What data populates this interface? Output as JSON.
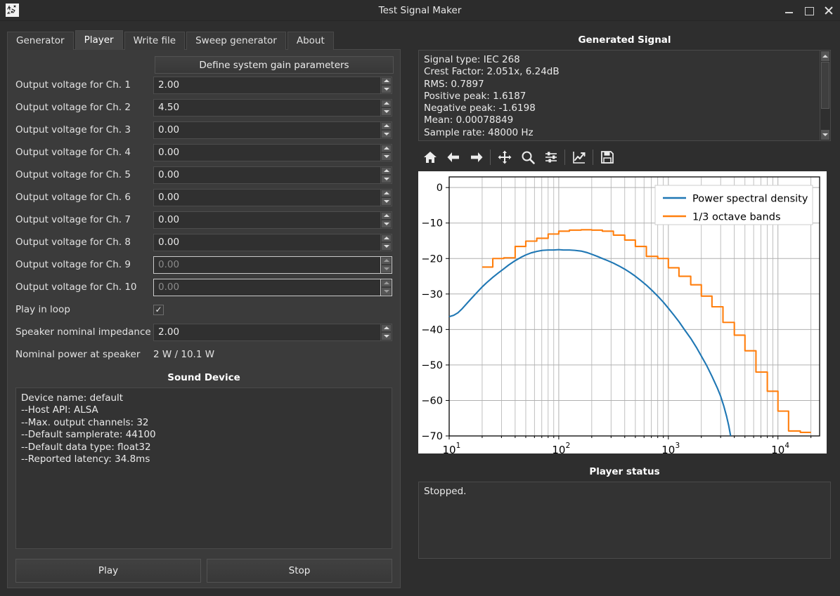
{
  "window": {
    "title": "Test Signal Maker",
    "app_icon": "signal-doodle-icon",
    "minimize": "–",
    "maximize": "□",
    "close": "✕"
  },
  "tabs": [
    {
      "label": "Generator",
      "active": false
    },
    {
      "label": "Player",
      "active": true
    },
    {
      "label": "Write file",
      "active": false
    },
    {
      "label": "Sweep generator",
      "active": false
    },
    {
      "label": "About",
      "active": false
    }
  ],
  "player": {
    "gain_button": "Define system gain parameters",
    "channels": [
      {
        "label": "Output voltage for Ch. 1",
        "value": "2.00",
        "enabled": true
      },
      {
        "label": "Output voltage for Ch. 2",
        "value": "4.50",
        "enabled": true
      },
      {
        "label": "Output voltage for Ch. 3",
        "value": "0.00",
        "enabled": true
      },
      {
        "label": "Output voltage for Ch. 4",
        "value": "0.00",
        "enabled": true
      },
      {
        "label": "Output voltage for Ch. 5",
        "value": "0.00",
        "enabled": true
      },
      {
        "label": "Output voltage for Ch. 6",
        "value": "0.00",
        "enabled": true
      },
      {
        "label": "Output voltage for Ch. 7",
        "value": "0.00",
        "enabled": true
      },
      {
        "label": "Output voltage for Ch. 8",
        "value": "0.00",
        "enabled": true
      },
      {
        "label": "Output voltage for Ch. 9",
        "value": "0.00",
        "enabled": false
      },
      {
        "label": "Output voltage for Ch. 10",
        "value": "0.00",
        "enabled": false
      }
    ],
    "loop_label": "Play in loop",
    "loop_checked": "✓",
    "impedance_label": "Speaker nominal impedance",
    "impedance_value": "2.00",
    "power_label": "Nominal power at speaker",
    "power_value": "2 W / 10.1 W",
    "play_button": "Play",
    "stop_button": "Stop"
  },
  "sound_device": {
    "title": "Sound Device",
    "text": "Device name: default\n--Host API: ALSA\n--Max. output channels: 32\n--Default samplerate: 44100\n--Default data type: float32\n--Reported latency: 34.8ms"
  },
  "generated_signal": {
    "title": "Generated Signal",
    "text": "Signal type: IEC 268\nCrest Factor: 2.051x, 6.24dB\nRMS: 0.7897\nPositive peak: 1.6187\nNegative peak: -1.6198\nMean: 0.00078849\nSample rate: 48000 Hz"
  },
  "plot_toolbar": [
    {
      "icon": "home-icon",
      "title": "Home"
    },
    {
      "icon": "arrow-left-icon",
      "title": "Back"
    },
    {
      "icon": "arrow-right-icon",
      "title": "Forward"
    },
    {
      "icon": "move-pan-icon",
      "title": "Pan"
    },
    {
      "icon": "magnifier-zoom-icon",
      "title": "Zoom"
    },
    {
      "icon": "sliders-configure-icon",
      "title": "Configure subplots"
    },
    {
      "icon": "edit-curves-icon",
      "title": "Edit axis/curve"
    },
    {
      "icon": "floppy-save-icon",
      "title": "Save figure"
    }
  ],
  "player_status": {
    "title": "Player status",
    "text": "Stopped."
  },
  "chart_data": {
    "type": "line",
    "title": "",
    "xlabel": "",
    "ylabel": "",
    "xscale": "log",
    "xlim": [
      10,
      24000
    ],
    "ylim": [
      -70,
      3
    ],
    "yticks": [
      0,
      -10,
      -20,
      -30,
      -40,
      -50,
      -60,
      -70
    ],
    "ytick_labels": [
      "0",
      "−10",
      "−20",
      "−30",
      "−40",
      "−50",
      "−60",
      "−70"
    ],
    "xticks": [
      10,
      100,
      1000,
      10000
    ],
    "xtick_labels": [
      "10¹",
      "10²",
      "10³",
      "10⁴"
    ],
    "grid": true,
    "legend_position": "upper right",
    "series": [
      {
        "name": "Power spectral density",
        "color": "#1f77b4",
        "style": "smooth",
        "points": [
          [
            10,
            -36.4
          ],
          [
            11,
            -36.0
          ],
          [
            12,
            -35.3
          ],
          [
            13,
            -34.3
          ],
          [
            14,
            -33.2
          ],
          [
            16,
            -31.2
          ],
          [
            18,
            -29.5
          ],
          [
            20,
            -28.0
          ],
          [
            22,
            -26.8
          ],
          [
            25,
            -25.3
          ],
          [
            28,
            -24.1
          ],
          [
            31.5,
            -22.9
          ],
          [
            35,
            -21.8
          ],
          [
            40,
            -20.6
          ],
          [
            45,
            -19.7
          ],
          [
            50,
            -19.0
          ],
          [
            56,
            -18.4
          ],
          [
            63,
            -18.0
          ],
          [
            71,
            -17.7
          ],
          [
            80,
            -17.6
          ],
          [
            90,
            -17.6
          ],
          [
            100,
            -17.5
          ],
          [
            110,
            -17.6
          ],
          [
            125,
            -17.6
          ],
          [
            140,
            -17.7
          ],
          [
            160,
            -17.9
          ],
          [
            180,
            -18.3
          ],
          [
            200,
            -18.8
          ],
          [
            225,
            -19.4
          ],
          [
            250,
            -20.0
          ],
          [
            280,
            -20.6
          ],
          [
            315,
            -21.3
          ],
          [
            355,
            -22.1
          ],
          [
            400,
            -23.0
          ],
          [
            450,
            -24.0
          ],
          [
            500,
            -25.0
          ],
          [
            560,
            -26.2
          ],
          [
            630,
            -27.5
          ],
          [
            710,
            -29.0
          ],
          [
            800,
            -30.6
          ],
          [
            900,
            -32.3
          ],
          [
            1000,
            -34.0
          ],
          [
            1120,
            -35.9
          ],
          [
            1250,
            -37.8
          ],
          [
            1400,
            -40.0
          ],
          [
            1600,
            -42.5
          ],
          [
            1800,
            -45.0
          ],
          [
            2000,
            -47.5
          ],
          [
            2240,
            -50.2
          ],
          [
            2500,
            -53.2
          ],
          [
            2800,
            -56.5
          ],
          [
            3000,
            -58.8
          ],
          [
            3200,
            -61.5
          ],
          [
            3400,
            -64.5
          ],
          [
            3550,
            -67.0
          ],
          [
            3700,
            -70.0
          ]
        ]
      },
      {
        "name": "1/3 octave bands",
        "color": "#ff7f0e",
        "style": "step",
        "points": [
          [
            20,
            -22.4
          ],
          [
            25,
            -22.4
          ],
          [
            25,
            -20.0
          ],
          [
            31.5,
            -20.0
          ],
          [
            31.5,
            -19.8
          ],
          [
            40,
            -19.8
          ],
          [
            40,
            -16.6
          ],
          [
            50,
            -16.6
          ],
          [
            50,
            -15.1
          ],
          [
            63,
            -15.1
          ],
          [
            63,
            -14.3
          ],
          [
            80,
            -14.3
          ],
          [
            80,
            -13.1
          ],
          [
            100,
            -13.1
          ],
          [
            100,
            -12.3
          ],
          [
            125,
            -12.3
          ],
          [
            125,
            -12.0
          ],
          [
            160,
            -12.0
          ],
          [
            160,
            -11.9
          ],
          [
            200,
            -11.9
          ],
          [
            200,
            -12.0
          ],
          [
            250,
            -12.0
          ],
          [
            250,
            -12.3
          ],
          [
            315,
            -12.3
          ],
          [
            315,
            -13.4
          ],
          [
            400,
            -13.4
          ],
          [
            400,
            -14.8
          ],
          [
            500,
            -14.8
          ],
          [
            500,
            -16.6
          ],
          [
            630,
            -16.6
          ],
          [
            630,
            -19.4
          ],
          [
            800,
            -19.4
          ],
          [
            800,
            -20.0
          ],
          [
            1000,
            -20.0
          ],
          [
            1000,
            -22.6
          ],
          [
            1250,
            -22.6
          ],
          [
            1250,
            -25.0
          ],
          [
            1600,
            -25.0
          ],
          [
            1600,
            -27.4
          ],
          [
            2000,
            -27.4
          ],
          [
            2000,
            -30.6
          ],
          [
            2500,
            -30.6
          ],
          [
            2500,
            -33.6
          ],
          [
            3150,
            -33.6
          ],
          [
            3150,
            -38.0
          ],
          [
            4000,
            -38.0
          ],
          [
            4000,
            -41.6
          ],
          [
            5000,
            -41.6
          ],
          [
            5000,
            -46.0
          ],
          [
            6300,
            -46.0
          ],
          [
            6300,
            -52.0
          ],
          [
            8000,
            -52.0
          ],
          [
            8000,
            -57.4
          ],
          [
            10000,
            -57.4
          ],
          [
            10000,
            -63.0
          ],
          [
            12500,
            -63.0
          ],
          [
            12500,
            -68.6
          ],
          [
            16000,
            -68.6
          ],
          [
            16000,
            -69.0
          ],
          [
            20000,
            -69.0
          ]
        ]
      }
    ]
  }
}
